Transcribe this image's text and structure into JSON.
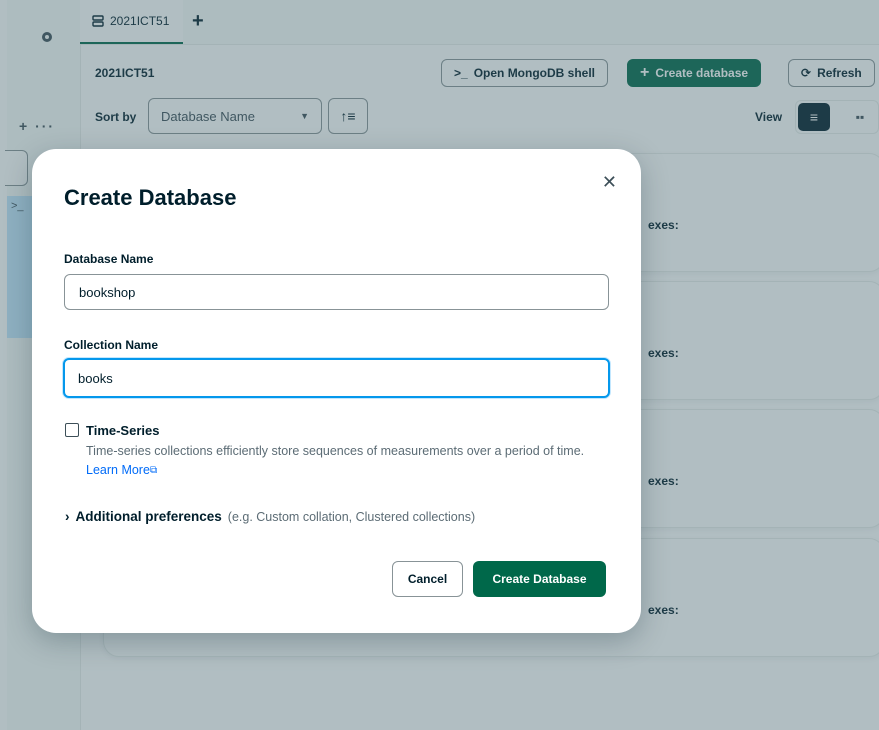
{
  "tab": {
    "label": "2021ICT51"
  },
  "header": {
    "title": "2021ICT51",
    "shell_label": "Open MongoDB shell",
    "create_label": "Create database",
    "refresh_label": "Refresh"
  },
  "toolbar": {
    "sort_label": "Sort by",
    "sort_value": "Database Name",
    "view_label": "View"
  },
  "cards": [
    {
      "text": "exes:"
    },
    {
      "text": "exes:"
    },
    {
      "text": "exes:"
    },
    {
      "text": "exes:"
    }
  ],
  "modal": {
    "title": "Create Database",
    "db_name_label": "Database Name",
    "db_name_value": "bookshop",
    "collection_label": "Collection Name",
    "collection_value": "books",
    "timeseries_label": "Time-Series",
    "timeseries_desc": "Time-series collections efficiently store sequences of measurements over a period of time.",
    "learn_more": "Learn More",
    "additional_label": "Additional preferences",
    "additional_hint": "(e.g. Custom collation, Clustered collections)",
    "cancel_label": "Cancel",
    "submit_label": "Create Database"
  },
  "colors": {
    "primary_green": "#00684a",
    "focus_blue": "#0498ec",
    "link_blue": "#016bf8"
  }
}
